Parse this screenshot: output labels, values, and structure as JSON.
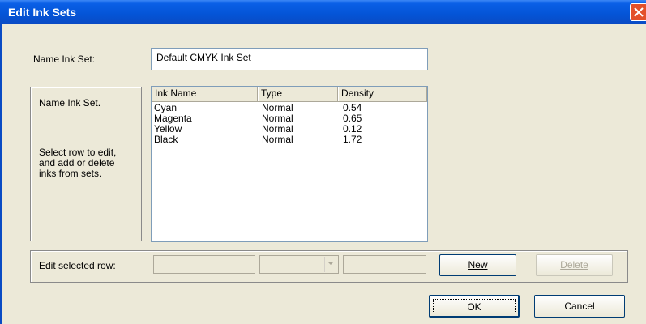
{
  "window": {
    "title": "Edit Ink Sets"
  },
  "form": {
    "name_label": "Name Ink Set:",
    "name_value": "Default CMYK Ink Set"
  },
  "help": {
    "heading": "Name Ink Set.",
    "text": "Select row to edit, and add or delete inks from sets."
  },
  "table": {
    "headers": [
      "Ink Name",
      "Type",
      "Density"
    ],
    "rows": [
      [
        "Cyan",
        "Normal",
        "0.54"
      ],
      [
        "Magenta",
        "Normal",
        "0.65"
      ],
      [
        "Yellow",
        "Normal",
        "0.12"
      ],
      [
        "Black",
        "Normal",
        "1.72"
      ]
    ]
  },
  "edit_row": {
    "label": "Edit selected row:"
  },
  "buttons": {
    "new": "New",
    "delete": "Delete",
    "ok": "OK",
    "cancel": "Cancel"
  },
  "colors": {
    "title_bar": "#0a5fe6",
    "close_button": "#e3502a",
    "dialog_bg": "#ece9d8"
  }
}
